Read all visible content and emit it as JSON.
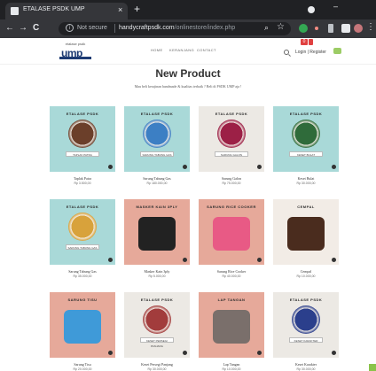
{
  "browser": {
    "tab_title": "ETALASE PSDK UMP",
    "tab_close": "×",
    "new_tab": "+",
    "back": "←",
    "forward": "→",
    "reload": "C",
    "not_secure": "Not secure",
    "url_host": "handycraftpsdk.com",
    "url_path": "/onlinestore/index.php",
    "menu": "⋮"
  },
  "site": {
    "logo_small": "etalase psdk",
    "logo_main": "ump",
    "nav": [
      "HOME",
      "KERANJANG",
      "CONTACT"
    ],
    "cart_count": "0",
    "user_links": "Login | Register"
  },
  "page": {
    "title": "New Product",
    "subtitle": "Mau beli kerajinan handmade & kualitas terbaik ? Beli di PSDK UMP aja !"
  },
  "products": [
    {
      "head": "ETALASE PSDK",
      "name": "Taplak Patra",
      "price": "Rp 3.500,00",
      "bg": "#a9d9d8",
      "accent": "#6b3f2a",
      "label": "TAPLAK PATRA"
    },
    {
      "head": "ETALASE PSDK",
      "name": "Sarung Tabung Gas",
      "price": "Rp 180.000,00",
      "bg": "#a9d9d8",
      "accent": "#3c7fc4",
      "label": "SARUNG TABUNG GAS"
    },
    {
      "head": "ETALASE PSDK",
      "name": "Sarung Galon",
      "price": "Rp 75.000,00",
      "bg": "#ece9e4",
      "accent": "#9c2046",
      "label": "SARUNG GALON"
    },
    {
      "head": "ETALASE PSDK",
      "name": "Keset Bulat",
      "price": "Rp 30.000,00",
      "bg": "#a9d9d8",
      "accent": "#2f6b3a",
      "label": "KESET BULAT"
    },
    {
      "head": "ETALASE PSDK",
      "name": "Sarung Tabung Gas",
      "price": "Rp 35.000,00",
      "bg": "#a9d9d8",
      "accent": "#d8a23b",
      "label": "SARUNG TABUNG GAS"
    },
    {
      "head": "MASKER KAIN 3PLY",
      "name": "Masker Kain 3ply",
      "price": "Rp 5.000,00",
      "bg": "#e6a99a",
      "accent": "#222222",
      "label": ""
    },
    {
      "head": "SARUNG RICE COOKER",
      "name": "Sarung Rice Cooker",
      "price": "Rp 40.000,00",
      "bg": "#e6a99a",
      "accent": "#e85a85",
      "label": ""
    },
    {
      "head": "CEMPAL",
      "name": "Cempal",
      "price": "Rp 10.000,00",
      "bg": "#f2ece6",
      "accent": "#4a2c1e",
      "label": ""
    },
    {
      "head": "SARUNG TISU",
      "name": "Sarung Tisu",
      "price": "Rp 20.000,00",
      "bg": "#e6a99a",
      "accent": "#3f9ad8",
      "label": ""
    },
    {
      "head": "ETALASE PSDK",
      "name": "Keset Persegi Panjang",
      "price": "Rp 30.000,00",
      "bg": "#ece9e4",
      "accent": "#a23c3c",
      "label": "KESET PERSEGI PANJANG"
    },
    {
      "head": "LAP TANGAN",
      "name": "Lap Tangan",
      "price": "Rp 10.000,00",
      "bg": "#e6a99a",
      "accent": "#7a6f6b",
      "label": ""
    },
    {
      "head": "ETALASE PSDK",
      "name": "Keset Karakter",
      "price": "Rp 30.000,00",
      "bg": "#ece9e4",
      "accent": "#2b3f8c",
      "label": "KESET KARAKTER"
    }
  ]
}
